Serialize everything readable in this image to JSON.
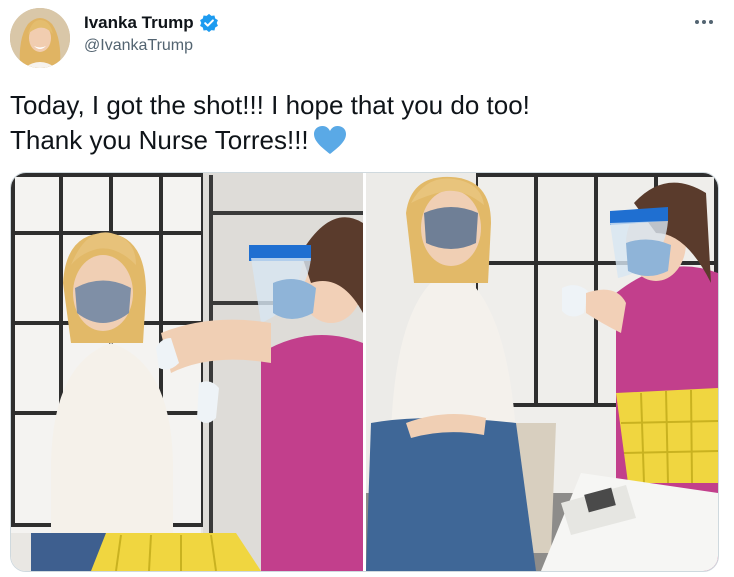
{
  "author": {
    "display_name": "Ivanka Trump",
    "handle": "@IvankaTrump",
    "verified": true,
    "verified_icon": "verified-badge-icon",
    "verified_color": "#1d9bf0"
  },
  "tweet": {
    "text": "Today, I got the shot!!! I hope that you do too!\nThank you Nurse Torres!!!",
    "emoji_icon": "blue-heart-icon",
    "emoji_color": "#5aa9e6"
  },
  "menu": {
    "icon": "more-options-icon"
  },
  "media": {
    "photos": [
      {
        "name": "vaccination-photo-1"
      },
      {
        "name": "vaccination-photo-2"
      }
    ]
  },
  "colors": {
    "text": "#0f1419",
    "secondary_text": "#536471",
    "border": "#cfd9de",
    "scrubs": "#c23f8c",
    "face_shield_band": "#1f6fd1",
    "basket": "#f0d640"
  }
}
